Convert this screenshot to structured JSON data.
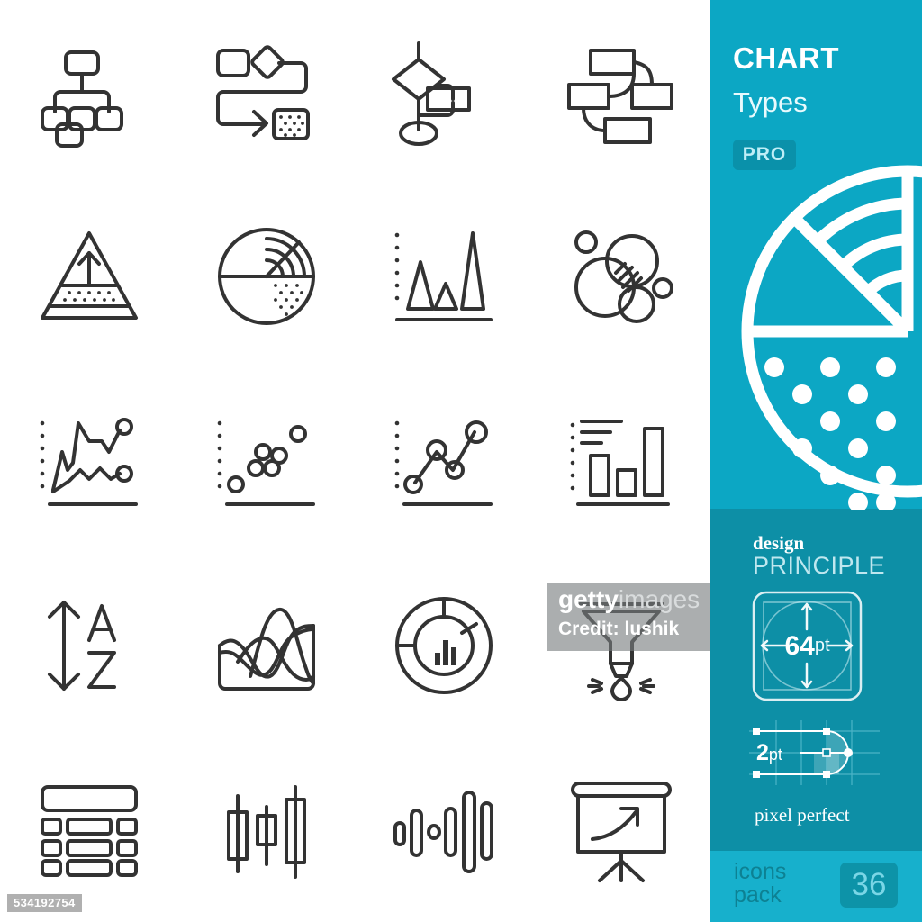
{
  "panel": {
    "title": "CHART",
    "subtitle": "Types",
    "pro_badge": "PRO",
    "design_label": "design",
    "principle_label": "PRINCIPLE",
    "size_value": "64",
    "size_unit": "pt",
    "stroke_value": "2",
    "stroke_unit": "pt",
    "pixel_perfect_label": "pixel perfect",
    "icons_pack_line1": "icons",
    "icons_pack_line2": "pack",
    "icon_count": "36",
    "colors": {
      "band_top": "#0ca7c4",
      "band_mid": "#0d8fa6",
      "band_bottom": "#17b0cc",
      "badge_bg": "#0d93a8",
      "badge_text": "#7ad6e6",
      "white": "#ffffff"
    }
  },
  "watermark": {
    "brand_bold": "getty",
    "brand_light": "images",
    "credit": "Credit: lushik",
    "asset_id": "534192754"
  },
  "grid": {
    "columns": 4,
    "rows": 5,
    "stroke_color": "#333333",
    "background": "#ffffff",
    "icons": [
      {
        "name": "organization-chart-icon",
        "label": "Organization chart"
      },
      {
        "name": "process-flow-chart-icon",
        "label": "Process flow chart"
      },
      {
        "name": "flowchart-decision-icon",
        "label": "Flowchart with decision node"
      },
      {
        "name": "network-diagram-icon",
        "label": "Network / relationship diagram"
      },
      {
        "name": "pyramid-chart-icon",
        "label": "Pyramid chart"
      },
      {
        "name": "pie-chart-icon",
        "label": "Pie chart"
      },
      {
        "name": "triangle-bar-chart-icon",
        "label": "Triangle bar chart"
      },
      {
        "name": "bubble-chart-icon",
        "label": "Bubble chart"
      },
      {
        "name": "area-chart-icon",
        "label": "Area / spline chart"
      },
      {
        "name": "scatter-plot-icon",
        "label": "Scatter plot"
      },
      {
        "name": "line-chart-markers-icon",
        "label": "Line chart with markers"
      },
      {
        "name": "bar-chart-icon",
        "label": "Bar chart"
      },
      {
        "name": "sort-az-icon",
        "label": "Sort A to Z"
      },
      {
        "name": "stream-graph-icon",
        "label": "Stream graph"
      },
      {
        "name": "donut-chart-icon",
        "label": "Donut chart"
      },
      {
        "name": "funnel-chart-icon",
        "label": "Funnel chart"
      },
      {
        "name": "data-table-icon",
        "label": "Data table"
      },
      {
        "name": "candlestick-chart-icon",
        "label": "Candlestick chart"
      },
      {
        "name": "column-sparkline-icon",
        "label": "Column sparkline chart"
      },
      {
        "name": "presentation-chart-icon",
        "label": "Presentation board with growth arrow"
      }
    ]
  }
}
